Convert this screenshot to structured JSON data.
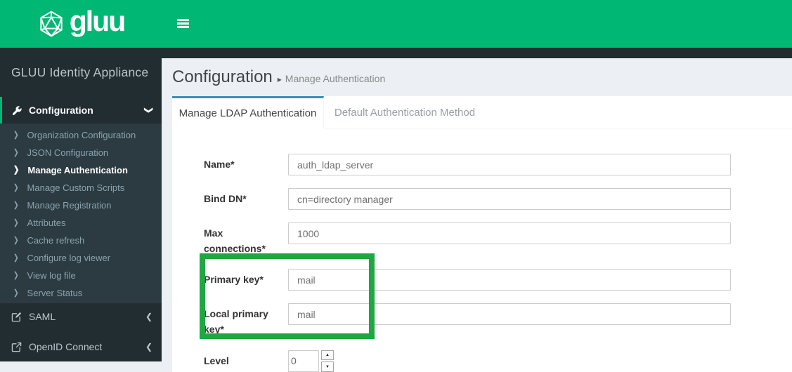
{
  "colors": {
    "brand_green": "#00b873",
    "sidebar_bg": "#222d32",
    "submenu_bg": "#2c3b41",
    "content_bg": "#ecf0f5",
    "tab_accent_blue": "#3c8dbc",
    "annotation_green": "#1fa743"
  },
  "navbar": {
    "logo_text": "gluu"
  },
  "sidebar": {
    "app_title": "GLUU Identity Appliance",
    "configuration": {
      "label": "Configuration",
      "items": [
        {
          "label": "Organization Configuration",
          "active": false
        },
        {
          "label": "JSON Configuration",
          "active": false
        },
        {
          "label": "Manage Authentication",
          "active": true
        },
        {
          "label": "Manage Custom Scripts",
          "active": false
        },
        {
          "label": "Manage Registration",
          "active": false
        },
        {
          "label": "Attributes",
          "active": false
        },
        {
          "label": "Cache refresh",
          "active": false
        },
        {
          "label": "Configure log viewer",
          "active": false
        },
        {
          "label": "View log file",
          "active": false
        },
        {
          "label": "Server Status",
          "active": false
        }
      ]
    },
    "saml_label": "SAML",
    "openid_label": "OpenID Connect"
  },
  "page": {
    "title": "Configuration",
    "breadcrumb": "Manage Authentication"
  },
  "tabs": {
    "active": "Manage LDAP Authentication",
    "inactive": "Default Authentication Method"
  },
  "form": {
    "fields": [
      {
        "label": "Name*",
        "value": "auth_ldap_server"
      },
      {
        "label": "Bind DN*",
        "value": "cn=directory manager"
      },
      {
        "label": "Max connections*",
        "value": "1000"
      },
      {
        "label": "Primary key*",
        "value": "mail"
      },
      {
        "label": "Local primary key*",
        "value": "mail"
      },
      {
        "label": "Level",
        "value": "0"
      }
    ]
  },
  "icons": {
    "submenu_chevron": "❯",
    "collapse_chevron": "❮",
    "expand_chevron": "❯",
    "breadcrumb_arrow": "▸",
    "spinner_up": "▲",
    "spinner_down": "▼"
  }
}
